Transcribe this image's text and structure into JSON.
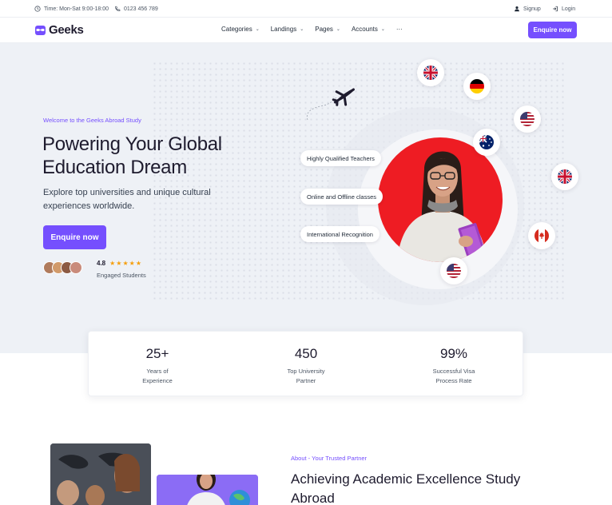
{
  "topbar": {
    "hours": "Time: Mon-Sat 9:00-18:00",
    "phone": "0123 456 789",
    "signup": "Signup",
    "login": "Login"
  },
  "navbar": {
    "brand": "Geeks",
    "menu": [
      {
        "label": "Categories"
      },
      {
        "label": "Landings"
      },
      {
        "label": "Pages"
      },
      {
        "label": "Accounts"
      }
    ],
    "more": "···",
    "cta": "Enquire now"
  },
  "hero": {
    "eyebrow": "Welcome to the Geeks Abroad Study",
    "title": "Powering Your Global Education Dream",
    "subtitle": "Explore top universities and unique cultural experiences worldwide.",
    "button": "Enquire now",
    "rating": "4.8",
    "stars": "★★★★★",
    "engaged": "Engaged Students",
    "features": [
      "Highly Qualified Teachers",
      "Online and Offline classes",
      "International Recognition"
    ],
    "flags": [
      "uk-flag-icon",
      "germany-flag-icon",
      "usa-flag-icon",
      "australia-flag-icon",
      "uk-flag-icon",
      "canada-flag-icon",
      "usa-flag-icon"
    ]
  },
  "stats": [
    {
      "value": "25+",
      "label": "Years of Experience"
    },
    {
      "value": "450",
      "label": "Top University Partner"
    },
    {
      "value": "99%",
      "label": "Successful Visa Process Rate"
    }
  ],
  "about": {
    "eyebrow": "About - Your Trusted Partner",
    "title": "Achieving Academic Excellence Study Abroad"
  },
  "colors": {
    "accent": "#754ffe",
    "hero_bg": "#eef1f6",
    "red_circle": "#ee1c23",
    "star": "#f59e0b"
  }
}
